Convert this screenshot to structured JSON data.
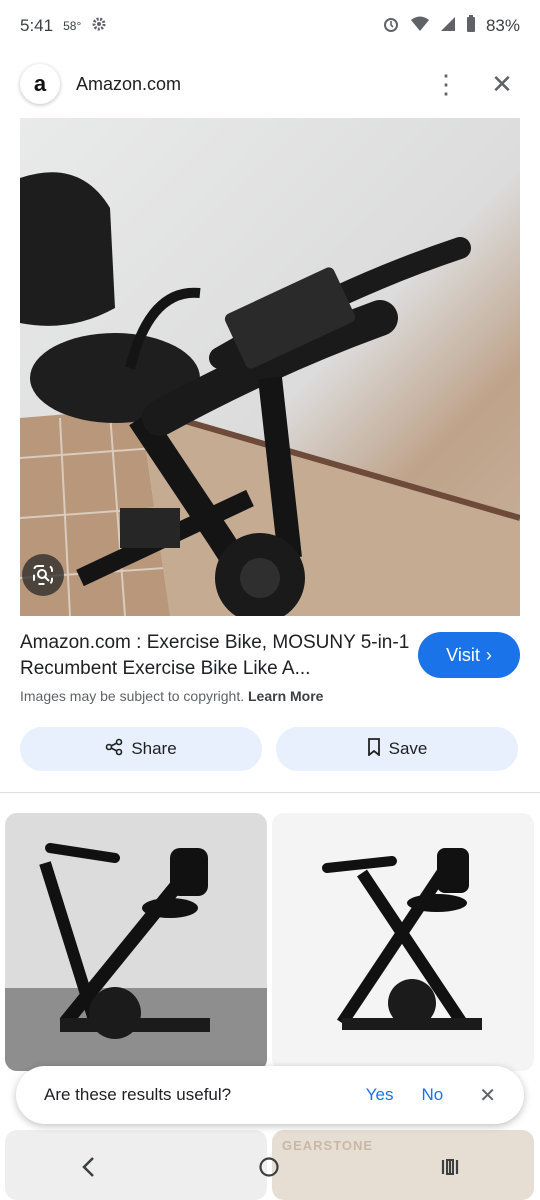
{
  "status_bar": {
    "time": "5:41",
    "temperature": "58°",
    "battery": "83%",
    "icons": [
      "gear-icon",
      "alarm-icon",
      "wifi-icon",
      "signal-icon",
      "battery-icon"
    ]
  },
  "header": {
    "site_logo": "a",
    "site_name": "Amazon.com",
    "menu_icon": "⋮",
    "close_icon": "✕"
  },
  "result": {
    "title": "Amazon.com : Exercise Bike, MOSUNY 5-in-1 Recumbent Exercise Bike Like A...",
    "visit_label": "Visit",
    "copyright_text": "Images may be subject to copyright.",
    "learn_more": "Learn More"
  },
  "actions": {
    "share_label": "Share",
    "save_label": "Save"
  },
  "feedback": {
    "question": "Are these results useful?",
    "yes": "Yes",
    "no": "No"
  },
  "thumbnails_overlay_text": "GEARSTONE",
  "colors": {
    "accent": "#1a73e8",
    "chip_bg": "#e8f0fe"
  }
}
